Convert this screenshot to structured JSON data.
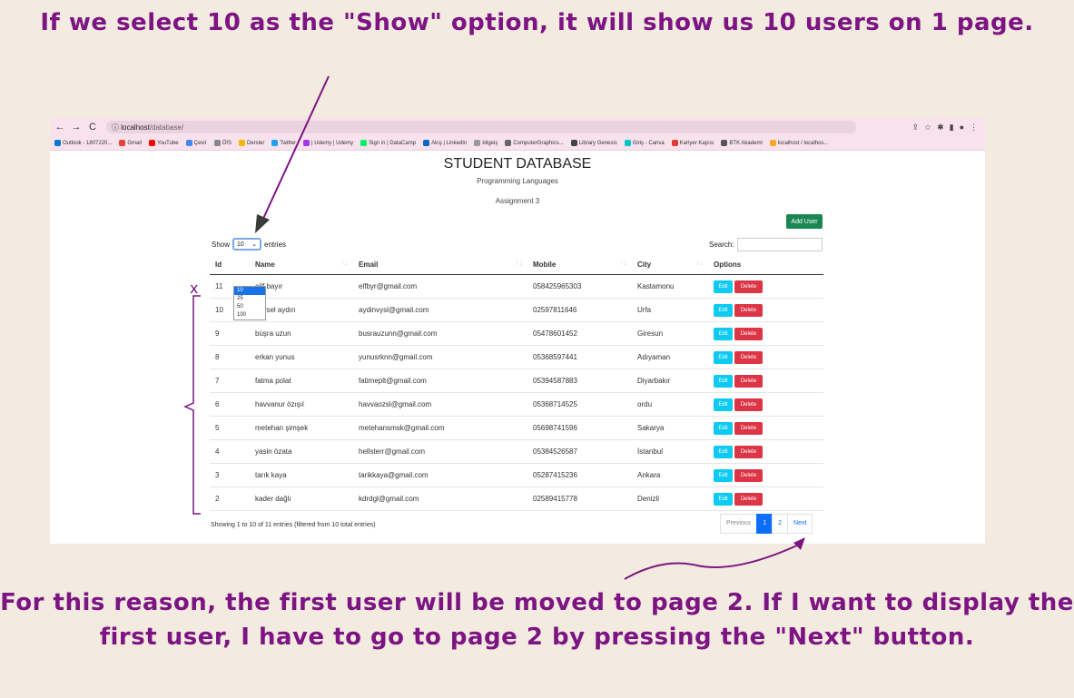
{
  "captions": {
    "top": "If we select 10 as the \"Show\" option, it will show us 10 users on 1 page.",
    "bottom": "For this reason, the first user will be moved to page 2. If I want to display the first user, I have to go to page 2 by pressing the \"Next\" button.",
    "marker": "x"
  },
  "browser": {
    "url_host": "localhost",
    "url_path": "/database/",
    "bookmarks": [
      {
        "label": "Outlook - 1807220...",
        "color": "#0078d4"
      },
      {
        "label": "Gmail",
        "color": "#ea4335"
      },
      {
        "label": "YouTube",
        "color": "#ff0000"
      },
      {
        "label": "Çevir",
        "color": "#4285f4"
      },
      {
        "label": "ÖİS",
        "color": "#888888"
      },
      {
        "label": "Dersler",
        "color": "#f4b400"
      },
      {
        "label": "Twitter",
        "color": "#1da1f2"
      },
      {
        "label": "| Udemy | Udemy",
        "color": "#a435f0"
      },
      {
        "label": "Sign in | DataCamp",
        "color": "#03ef62"
      },
      {
        "label": "Akış | LinkedIn",
        "color": "#0a66c2"
      },
      {
        "label": "bilgeiş",
        "color": "#999999"
      },
      {
        "label": "ComputerGraphics...",
        "color": "#666666"
      },
      {
        "label": "Library Genesis",
        "color": "#444444"
      },
      {
        "label": "Giriş - Canva",
        "color": "#00c4cc"
      },
      {
        "label": "Kariyer Kapısı",
        "color": "#e53935"
      },
      {
        "label": "BTK Akademi",
        "color": "#555555"
      },
      {
        "label": "localhost / localhos...",
        "color": "#f9a825"
      }
    ]
  },
  "app": {
    "title": "STUDENT DATABASE",
    "subtitle1": "Programming Languages",
    "subtitle2": "Assignment 3",
    "add_user": "Add User",
    "show_label": "Show",
    "show_value": "10",
    "entries_label": "entries",
    "show_options": [
      "10",
      "25",
      "50",
      "100"
    ],
    "search_label": "Search:",
    "columns": [
      "Id",
      "Name",
      "Email",
      "Mobile",
      "City",
      "Options"
    ],
    "rows": [
      {
        "id": "11",
        "name": "elif bayır",
        "email": "elfbyr@gmail.com",
        "mobile": "058425965303",
        "city": "Kastamonu"
      },
      {
        "id": "10",
        "name": "veysel aydın",
        "email": "aydinvysl@gmail.com",
        "mobile": "02597811646",
        "city": "Urfa"
      },
      {
        "id": "9",
        "name": "büşra uzun",
        "email": "busrauzunn@gmail.com",
        "mobile": "05478601452",
        "city": "Giresun"
      },
      {
        "id": "8",
        "name": "erkan yunus",
        "email": "yunusrknn@gmail.com",
        "mobile": "05368597441",
        "city": "Adıyaman"
      },
      {
        "id": "7",
        "name": "fatma polat",
        "email": "fatimeplt@gmail.com",
        "mobile": "05394587883",
        "city": "Diyarbakır"
      },
      {
        "id": "6",
        "name": "havvanur özışıl",
        "email": "havvaozsl@gmail.com",
        "mobile": "05368714525",
        "city": "ordu"
      },
      {
        "id": "5",
        "name": "metehan şimşek",
        "email": "metehansmsk@gmail.com",
        "mobile": "05698741596",
        "city": "Sakarya"
      },
      {
        "id": "4",
        "name": "yasin özata",
        "email": "hellsterr@gmail.com",
        "mobile": "05384526587",
        "city": "İstanbul"
      },
      {
        "id": "3",
        "name": "tarık kaya",
        "email": "tarikkaya@gmail.com",
        "mobile": "05287415236",
        "city": "Ankara"
      },
      {
        "id": "2",
        "name": "kader dağlı",
        "email": "kdrdgl@gmail.com",
        "mobile": "02589415778",
        "city": "Denizli"
      }
    ],
    "edit_label": "Edit",
    "delete_label": "Delete",
    "info": "Showing 1 to 10 of 11 entries (filtered from 10 total entries)",
    "pagination": {
      "previous": "Previous",
      "pages": [
        "1",
        "2"
      ],
      "next": "Next"
    }
  },
  "colors": {
    "annotation": "#7d1483",
    "primary": "#0d6efd",
    "success": "#198754",
    "info": "#0dcaf0",
    "danger": "#dc3545"
  }
}
